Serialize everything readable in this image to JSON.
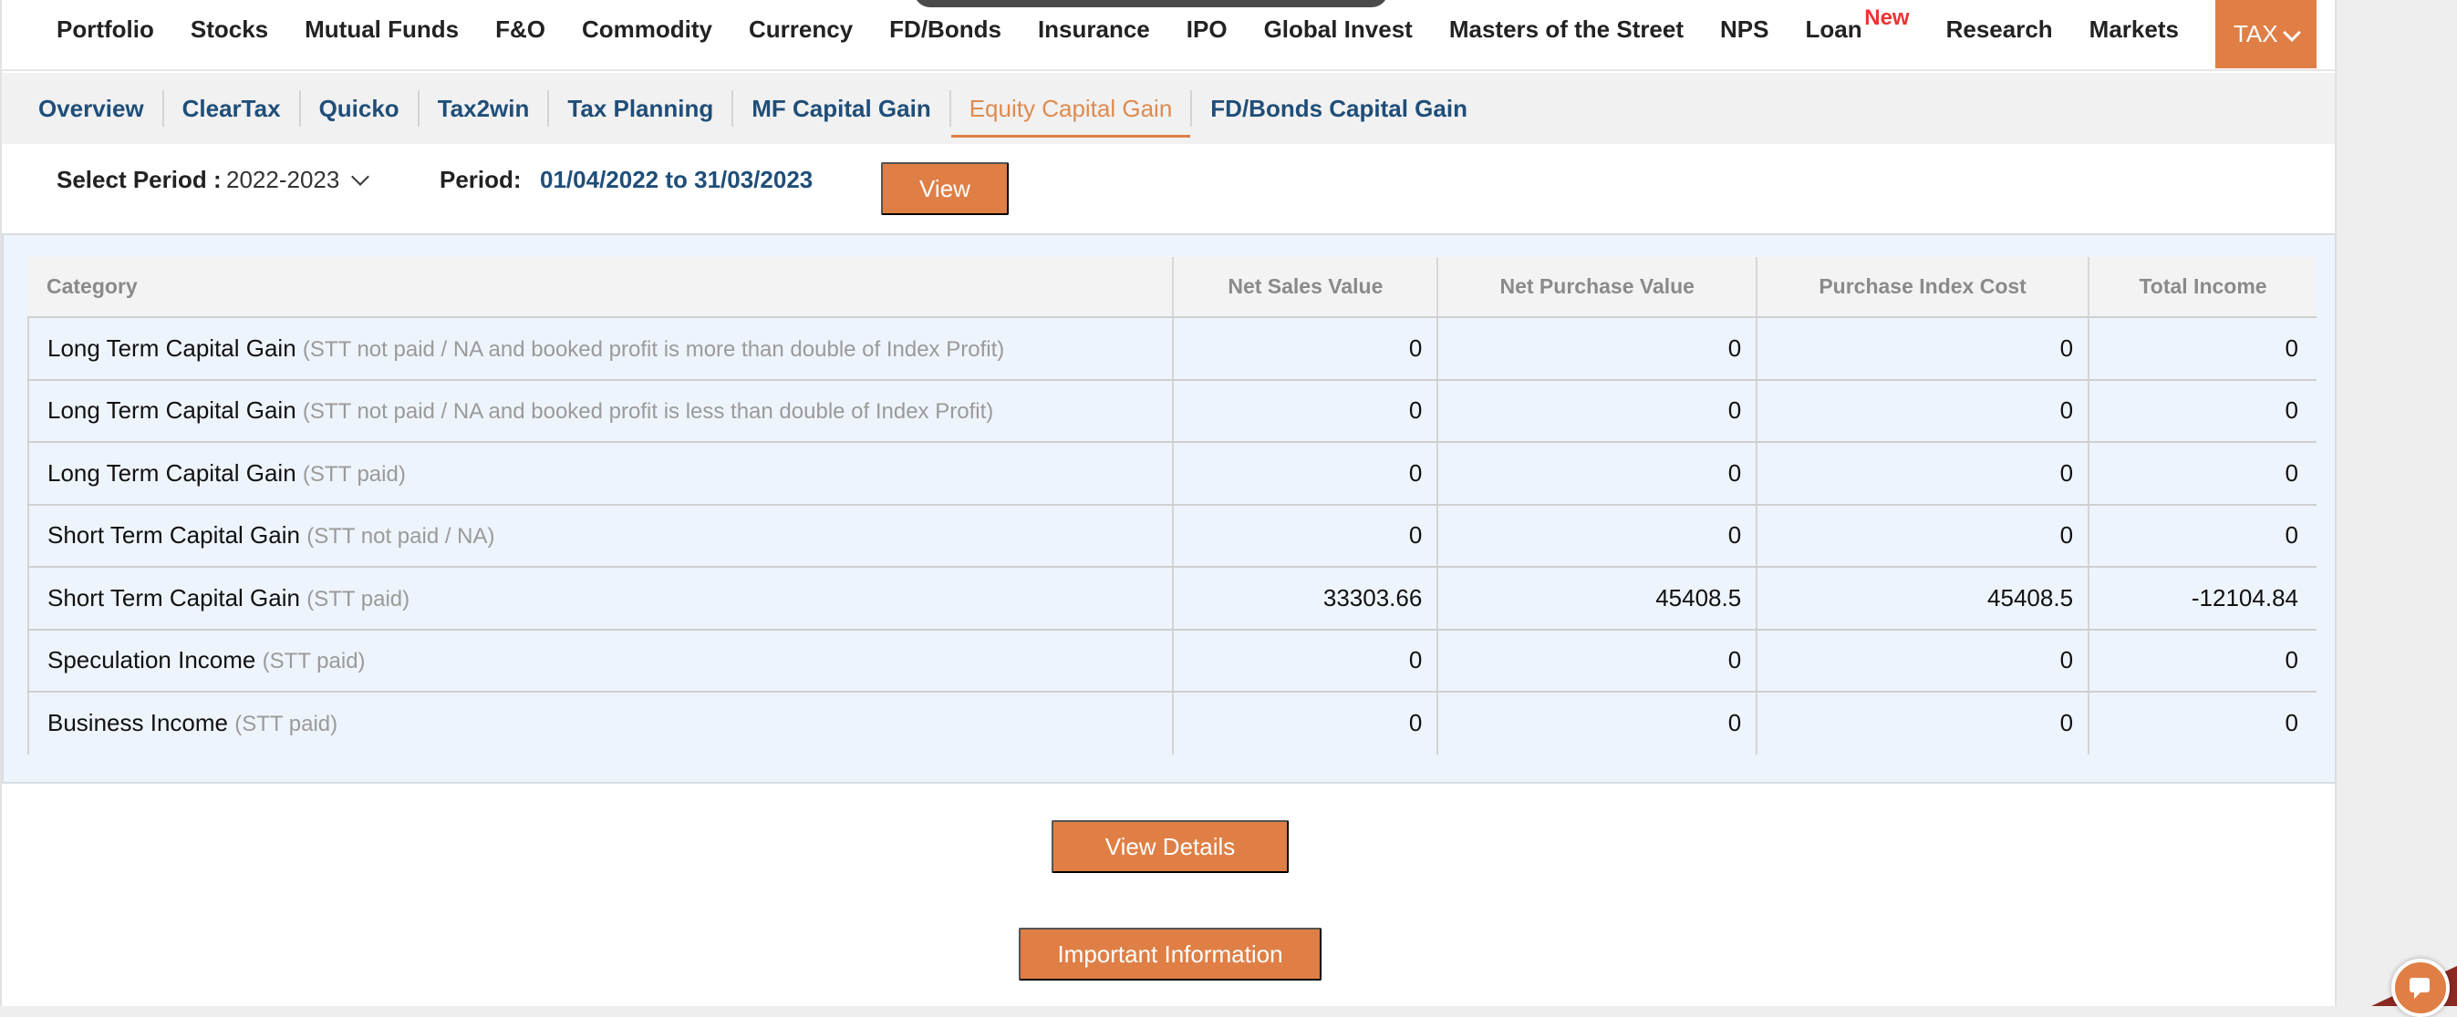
{
  "nav": {
    "items": [
      "Portfolio",
      "Stocks",
      "Mutual Funds",
      "F&O",
      "Commodity",
      "Currency",
      "FD/Bonds",
      "Insurance",
      "IPO",
      "Global Invest",
      "Masters of the Street",
      "NPS"
    ],
    "loan": "Loan",
    "loan_badge": "New",
    "items_after": [
      "Research",
      "Markets"
    ],
    "tax": "TAX"
  },
  "subnav": {
    "items": [
      "Overview",
      "ClearTax",
      "Quicko",
      "Tax2win",
      "Tax Planning",
      "MF Capital Gain",
      "Equity Capital Gain",
      "FD/Bonds Capital Gain"
    ],
    "active_index": 6
  },
  "period": {
    "select_label": "Select Period :",
    "selected": "2022-2023",
    "period_label": "Period:",
    "range": "01/04/2022 to 31/03/2023",
    "view_button": "View"
  },
  "table": {
    "headers": [
      "Category",
      "Net Sales Value",
      "Net Purchase Value",
      "Purchase Index Cost",
      "Total Income"
    ],
    "rows": [
      {
        "category": "Long Term Capital Gain",
        "note": "(STT not paid / NA and booked profit is more than double of Index Profit)",
        "net_sales": "0",
        "net_purchase": "0",
        "index_cost": "0",
        "total_income": "0"
      },
      {
        "category": "Long Term Capital Gain",
        "note": "(STT not paid / NA and booked profit is less than double of Index Profit)",
        "net_sales": "0",
        "net_purchase": "0",
        "index_cost": "0",
        "total_income": "0"
      },
      {
        "category": "Long Term Capital Gain",
        "note": "(STT paid)",
        "net_sales": "0",
        "net_purchase": "0",
        "index_cost": "0",
        "total_income": "0"
      },
      {
        "category": "Short Term Capital Gain",
        "note": "(STT not paid / NA)",
        "net_sales": "0",
        "net_purchase": "0",
        "index_cost": "0",
        "total_income": "0"
      },
      {
        "category": "Short Term Capital Gain",
        "note": "(STT paid)",
        "net_sales": "33303.66",
        "net_purchase": "45408.5",
        "index_cost": "45408.5",
        "total_income": "-12104.84"
      },
      {
        "category": "Speculation Income",
        "note": "(STT paid)",
        "net_sales": "0",
        "net_purchase": "0",
        "index_cost": "0",
        "total_income": "0"
      },
      {
        "category": "Business Income",
        "note": "(STT paid)",
        "net_sales": "0",
        "net_purchase": "0",
        "index_cost": "0",
        "total_income": "0"
      }
    ]
  },
  "buttons": {
    "view_details": "View Details",
    "important_info": "Important Information"
  },
  "colors": {
    "accent": "#df7f45",
    "link": "#1f4e79",
    "table_bg": "#eef4fb"
  }
}
